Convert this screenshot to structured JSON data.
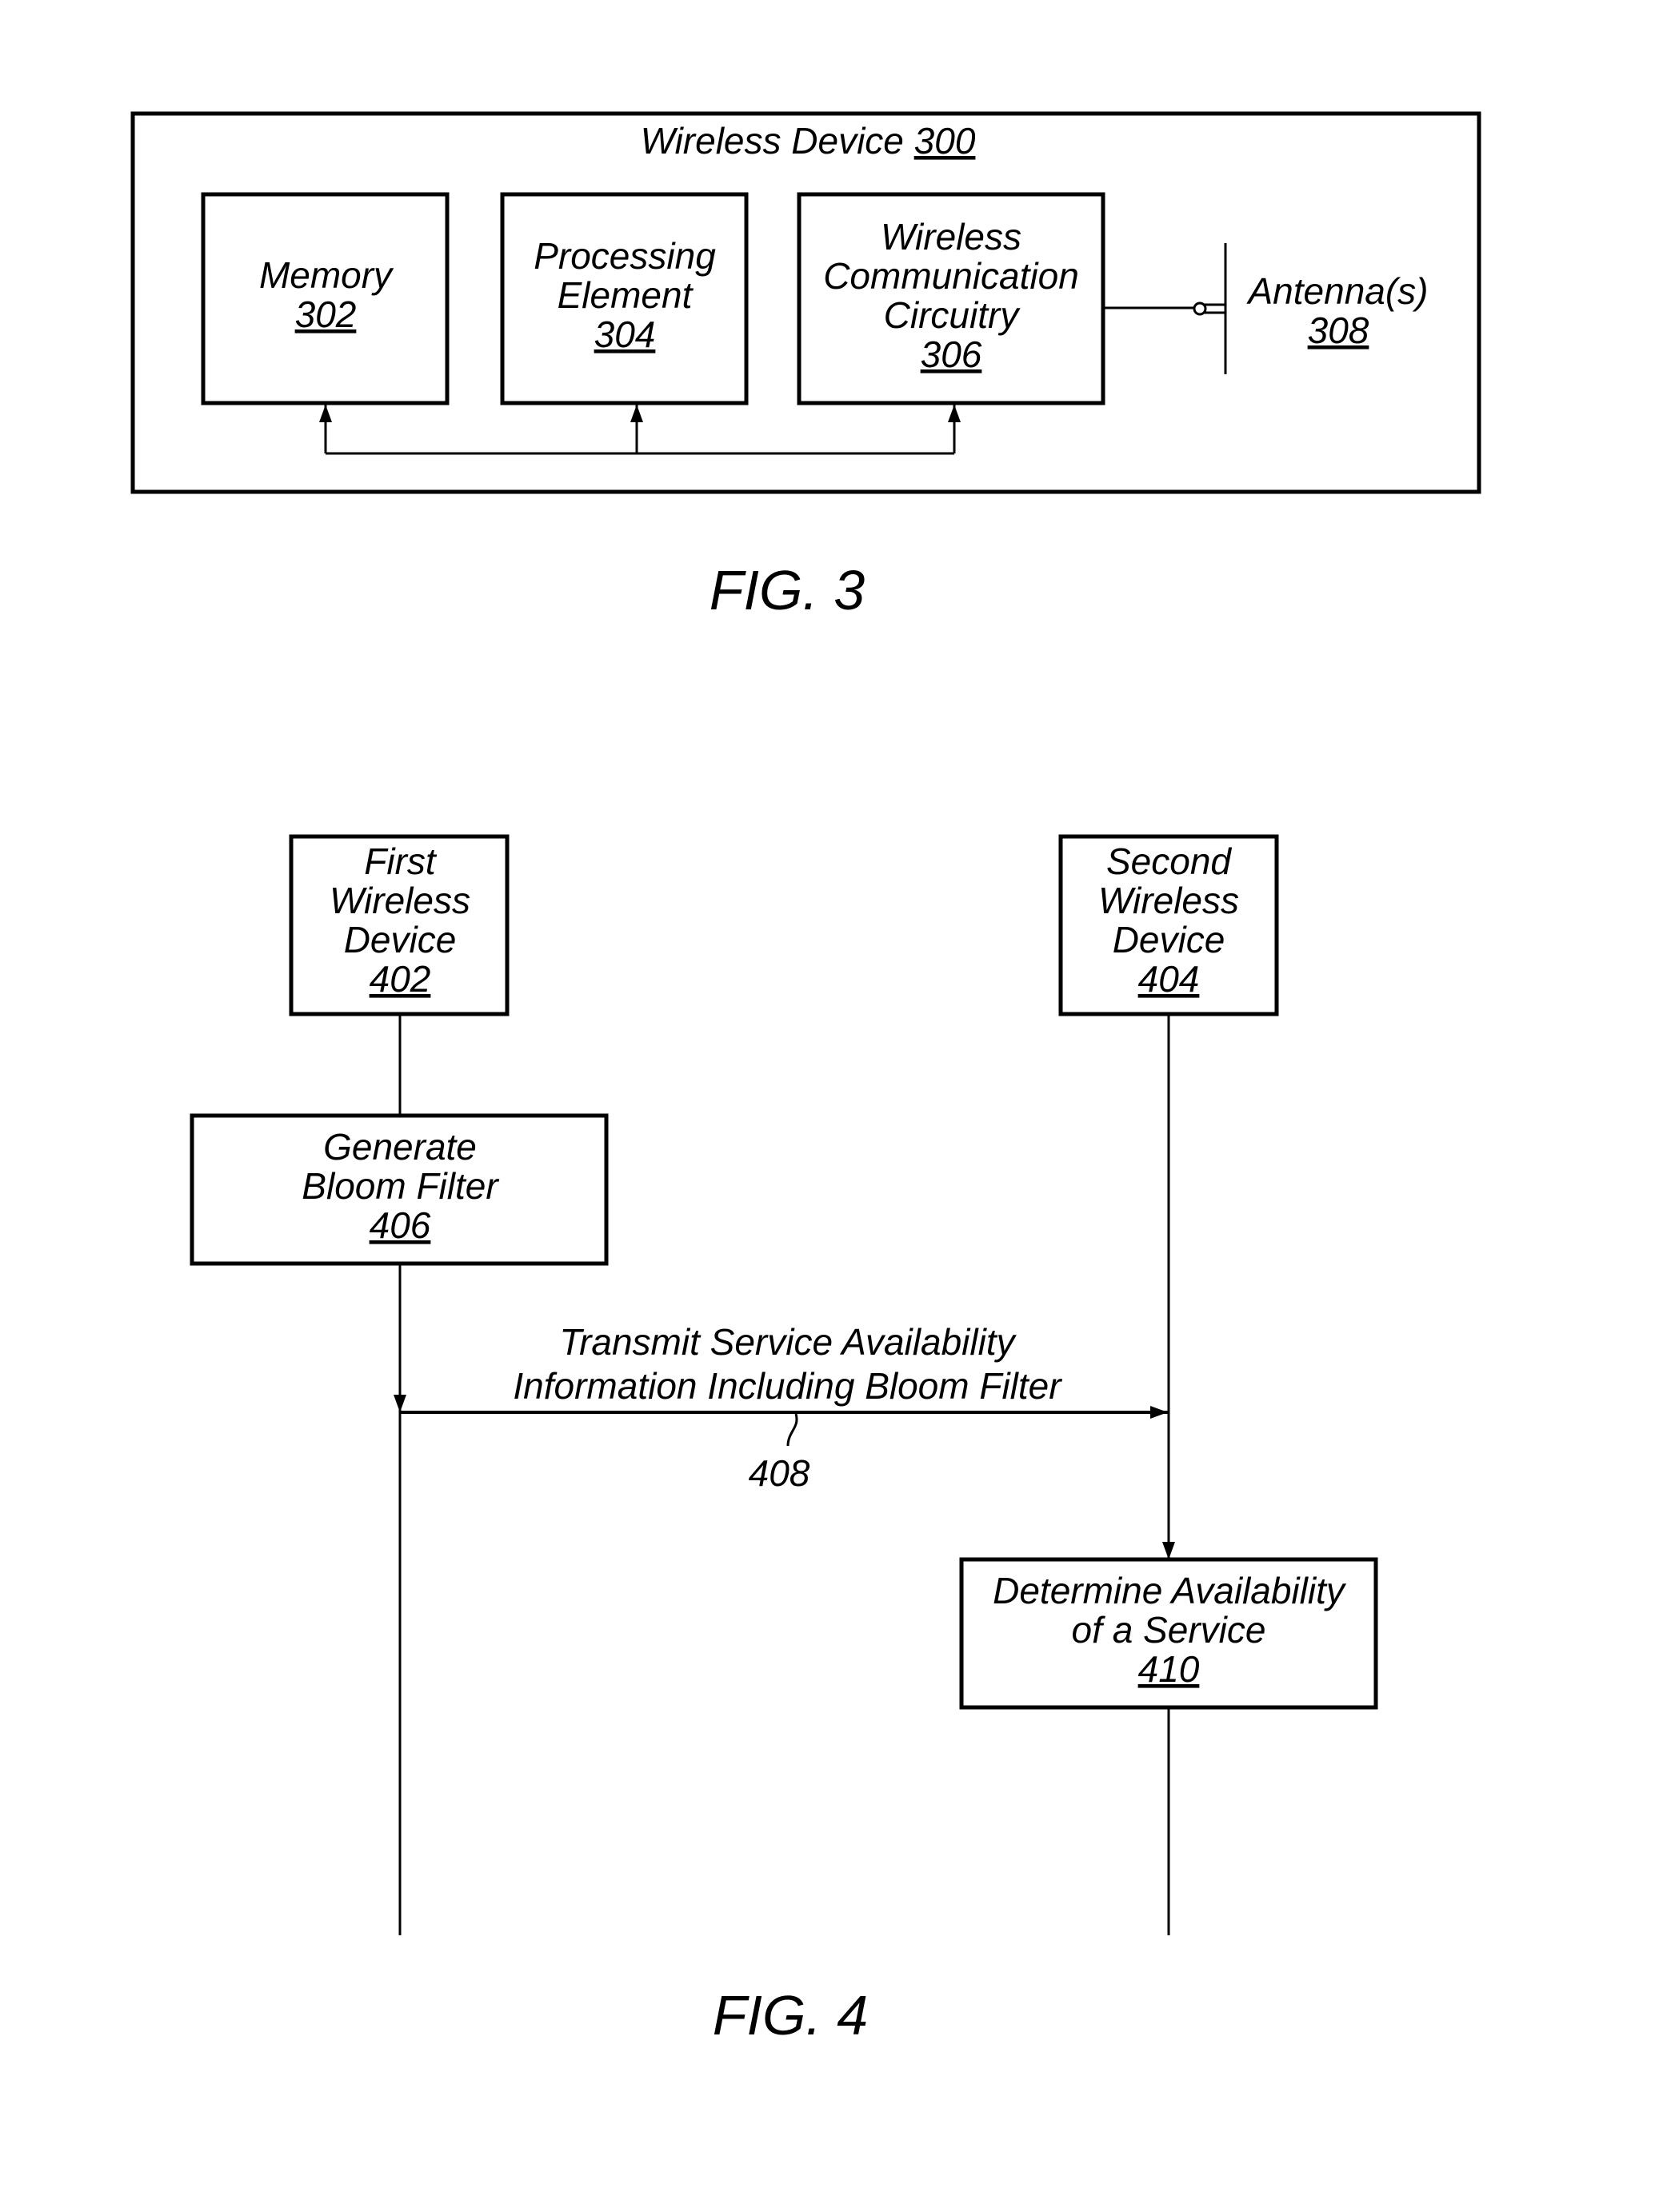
{
  "fig3": {
    "caption": "FIG. 3",
    "container": {
      "title": "Wireless Device",
      "ref": "300"
    },
    "blocks": [
      {
        "lines": [
          "Memory"
        ],
        "ref": "302"
      },
      {
        "lines": [
          "Processing",
          "Element"
        ],
        "ref": "304"
      },
      {
        "lines": [
          "Wireless",
          "Communication",
          "Circuitry"
        ],
        "ref": "306"
      }
    ],
    "antenna": {
      "label": "Antenna(s)",
      "ref": "308"
    }
  },
  "fig4": {
    "caption": "FIG. 4",
    "nodes": [
      {
        "lines": [
          "First",
          "Wireless",
          "Device"
        ],
        "ref": "402"
      },
      {
        "lines": [
          "Second",
          "Wireless",
          "Device"
        ],
        "ref": "404"
      },
      {
        "lines": [
          "Generate",
          "Bloom Filter"
        ],
        "ref": "406"
      },
      {
        "lines": [
          "Determine Availability",
          "of a Service"
        ],
        "ref": "410"
      }
    ],
    "message": {
      "lines": [
        "Transmit Service Availability",
        "Information Including Bloom Filter"
      ],
      "ref": "408"
    }
  }
}
